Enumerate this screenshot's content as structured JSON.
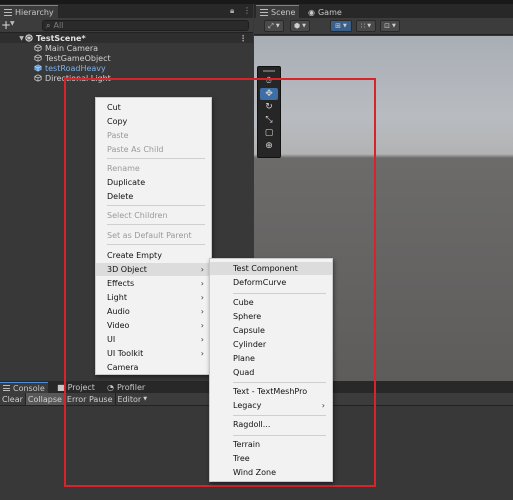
{
  "hierarchy": {
    "tab_label": "Hierarchy",
    "search_placeholder": "All",
    "scene_name": "TestScene*",
    "objects": [
      "Main Camera",
      "TestGameObject",
      "testRoadHeavy",
      "Directional Light"
    ]
  },
  "scene_view": {
    "tabs": [
      "Scene",
      "Game"
    ]
  },
  "console": {
    "tabs": [
      "Console",
      "Project",
      "Profiler"
    ],
    "toolbar": [
      "Clear",
      "Collapse",
      "Error Pause",
      "Editor"
    ]
  },
  "context_menu": {
    "items": [
      "Cut",
      "Copy",
      "Paste",
      "Paste As Child",
      "Rename",
      "Duplicate",
      "Delete",
      "Select Children",
      "Set as Default Parent",
      "Create Empty",
      "3D Object",
      "Effects",
      "Light",
      "Audio",
      "Video",
      "UI",
      "UI Toolkit",
      "Camera"
    ],
    "disabled": [
      "Paste",
      "Paste As Child",
      "Rename",
      "Select Children",
      "Set as Default Parent"
    ],
    "highlighted": "3D Object"
  },
  "submenu_3d_object": {
    "items": [
      "Test Component",
      "DeformCurve",
      "Cube",
      "Sphere",
      "Capsule",
      "Cylinder",
      "Plane",
      "Quad",
      "Text - TextMeshPro",
      "Legacy",
      "Ragdoll...",
      "Terrain",
      "Tree",
      "Wind Zone"
    ],
    "highlighted": "Test Component"
  },
  "colors": {
    "highlight_box": "#d9232a",
    "selected_object_text": "#7ab3ec",
    "active_tab_accent": "#4a8fd8"
  }
}
